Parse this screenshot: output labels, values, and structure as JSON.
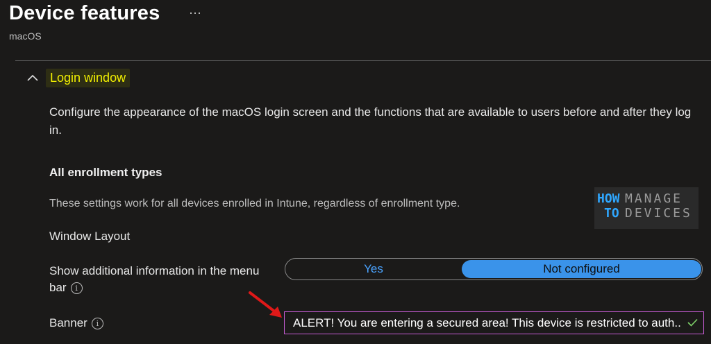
{
  "page": {
    "title": "Device features",
    "more_glyph": "···",
    "subtitle": "macOS"
  },
  "section": {
    "title": "Login window",
    "description": "Configure the appearance of the macOS login screen and the functions that are available to users before and after they log in."
  },
  "enrollment": {
    "heading": "All enrollment types",
    "note": "These settings work for all devices enrolled in Intune, regardless of enrollment type."
  },
  "window_layout": {
    "label": "Window Layout"
  },
  "menu_bar_setting": {
    "label": "Show additional information in the menu bar",
    "info_glyph": "i",
    "options": [
      "Yes",
      "Not configured"
    ],
    "selected": "Not configured"
  },
  "banner_setting": {
    "label": "Banner",
    "info_glyph": "i",
    "value": "ALERT! You are entering a secured area! This device is restricted to auth..."
  },
  "watermark": {
    "how": "HOW",
    "to": "TO",
    "manage": "MANAGE",
    "devices": "DEVICES"
  },
  "colors": {
    "background": "#1b1a19",
    "accent_blue": "#3a93ea",
    "highlight_yellow": "#f2f000",
    "field_border": "#c85dd6",
    "arrow_red": "#e01919"
  },
  "icons": {
    "more": "more-icon",
    "collapse": "chevron-up-icon",
    "info": "info-icon",
    "check": "check-icon",
    "annotation": "red-arrow-icon"
  }
}
